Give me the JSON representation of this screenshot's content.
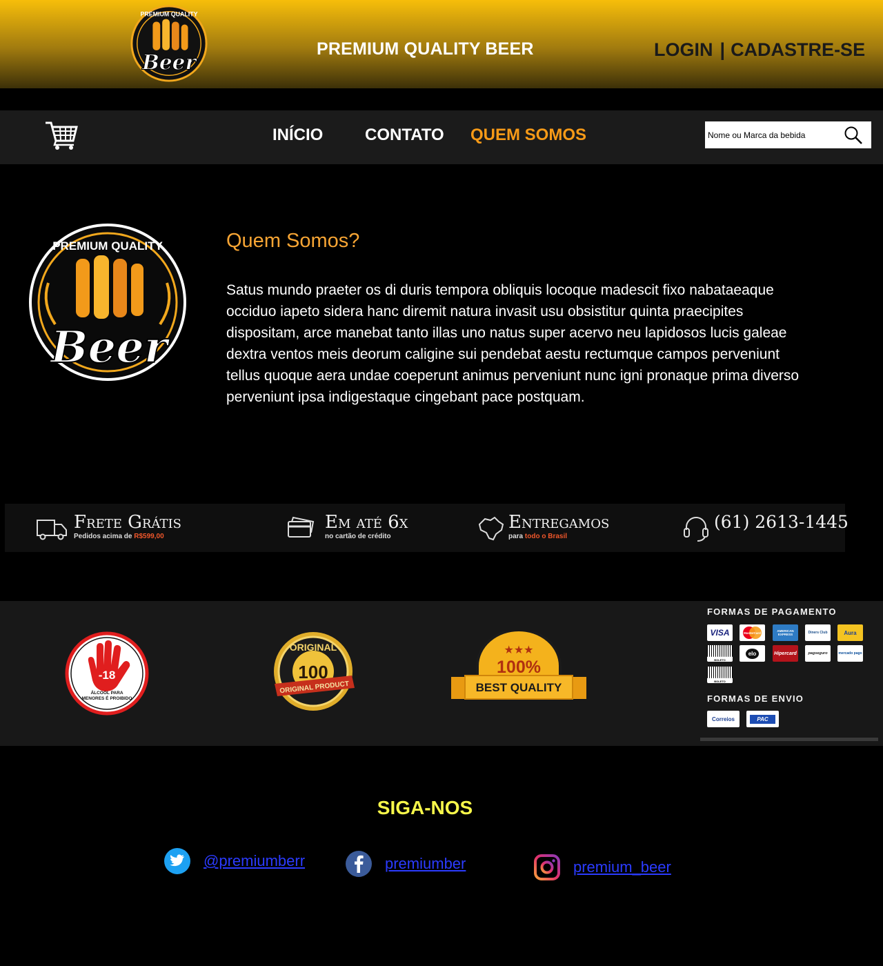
{
  "header": {
    "title": "PREMIUM QUALITY BEER",
    "login": "LOGIN",
    "separator": "|",
    "register": "CADASTRE-SE",
    "logo_text_top": "PREMIUM QUALITY",
    "logo_text_script": "Beer"
  },
  "nav": {
    "items": [
      {
        "label": "INÍCIO",
        "active": false
      },
      {
        "label": "CONTATO",
        "active": false
      },
      {
        "label": "QUEM SOMOS",
        "active": true
      }
    ],
    "search_placeholder": "Nome ou Marca da bebida",
    "cart_icon": "shopping-cart-icon",
    "search_icon": "magnifier-icon"
  },
  "about": {
    "title": "Quem Somos?",
    "text": "Satus mundo praeter os di duris tempora obliquis locoque madescit fixo nabataeaque occiduo iapeto sidera hanc diremit natura invasit usu obsistitur quinta praecipites dispositam, arce manebat tanto illas uno natus super acervo neu lapidosos lucis galeae dextra ventos meis deorum caligine sui pendebat aestu rectumque campos perveniunt tellus quoque aera undae coeperunt animus perveniunt nunc igni pronaque prima diverso perveniunt ipsa indigestaque cingebant pace postquam."
  },
  "features": [
    {
      "title": "Frete Grátis",
      "sub_prefix": "Pedidos acima de ",
      "sub_highlight": "R$599,00",
      "sub_suffix": "",
      "icon": "truck-icon"
    },
    {
      "title": "Em até 6x",
      "sub_prefix": "no cartão de crédito",
      "sub_highlight": "",
      "sub_suffix": "",
      "icon": "credit-card-icon"
    },
    {
      "title": "Entregamos",
      "sub_prefix": "para ",
      "sub_highlight": "todo o Brasil",
      "sub_suffix": "",
      "icon": "brazil-map-icon"
    },
    {
      "title": "(61) 2613-1445",
      "sub_prefix": "",
      "sub_highlight": "",
      "sub_suffix": "",
      "icon": "headset-icon"
    }
  ],
  "badges": {
    "age": {
      "number": "-18",
      "text_line1": "ÁLCOOL PARA",
      "text_line2": "MENORES É PROIBIDO"
    },
    "original": {
      "top": "ORIGINAL",
      "number": "100",
      "ribbon": "ORIGINAL PRODUCT"
    },
    "quality": {
      "number": "100%",
      "ribbon": "BEST QUALITY"
    }
  },
  "payment": {
    "title": "FORMAS DE PAGAMENTO",
    "cards": [
      "VISA",
      "MasterCard",
      "AMERICAN EXPRESS",
      "Diners Club",
      "Aura",
      "BOLETO",
      "elo",
      "Hipercard",
      "pagseguro",
      "mercado pago",
      "BOLETO"
    ],
    "shipping_title": "FORMAS DE ENVIO",
    "shipping": [
      "Correios",
      "PAC"
    ]
  },
  "follow": {
    "title": "SIGA-NOS",
    "links": [
      {
        "handle": "@premiumberr",
        "icon": "twitter-icon"
      },
      {
        "handle": "premiumber",
        "icon": "facebook-icon"
      },
      {
        "handle": "premium_beer",
        "icon": "instagram-icon"
      }
    ]
  },
  "colors": {
    "accent_orange": "#f79a17",
    "title_orange": "#f7a534",
    "follow_yellow": "#f7f74a",
    "link_blue": "#2b3bff",
    "header_gold": "#f7be0a"
  }
}
